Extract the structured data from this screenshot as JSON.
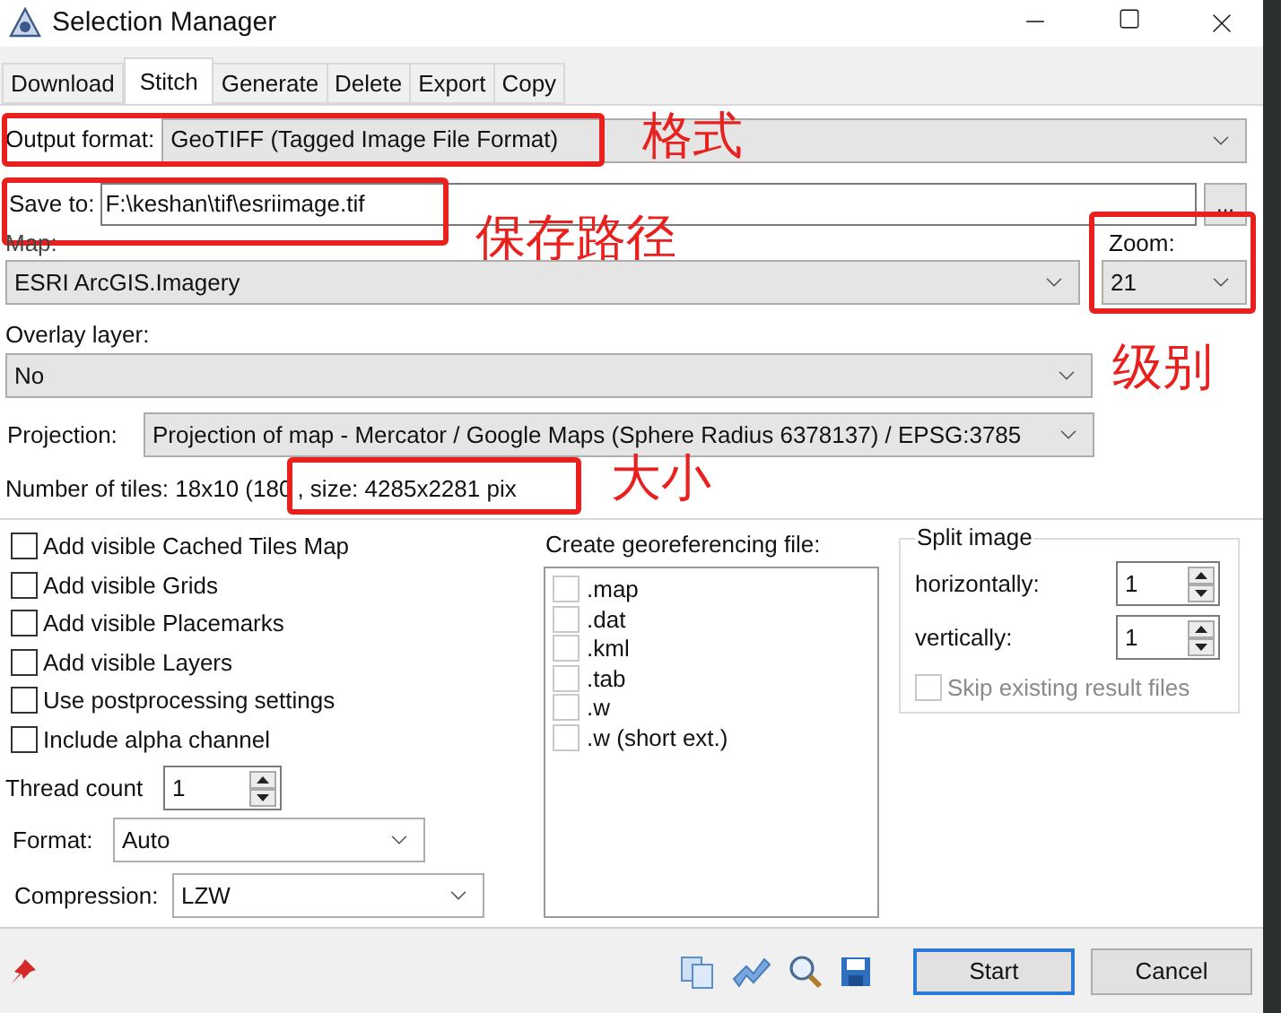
{
  "window": {
    "title": "Selection Manager"
  },
  "tabs": [
    {
      "label": "Download",
      "selected": false
    },
    {
      "label": "Stitch",
      "selected": true
    },
    {
      "label": "Generate",
      "selected": false
    },
    {
      "label": "Delete",
      "selected": false
    },
    {
      "label": "Export",
      "selected": false
    },
    {
      "label": "Copy",
      "selected": false
    }
  ],
  "output_format": {
    "label": "Output format:",
    "value": "GeoTIFF (Tagged Image File Format)",
    "annotation": "格式"
  },
  "save_to": {
    "label": "Save to:",
    "value": "F:\\keshan\\tif\\esriimage.tif",
    "browse": "...",
    "annotation": "保存路径"
  },
  "map": {
    "label": "Map:",
    "value": "ESRI ArcGIS.Imagery"
  },
  "zoom": {
    "label": "Zoom:",
    "value": "21",
    "annotation": "级别"
  },
  "overlay": {
    "label": "Overlay layer:",
    "value": "No"
  },
  "projection": {
    "label": "Projection:",
    "value": "Projection of map - Mercator / Google Maps (Sphere Radius 6378137) / EPSG:3785"
  },
  "tiles": {
    "count": "Number of tiles: 18x10 (180",
    "size": ", size: 4285x2281 pix",
    "annotation": "大小"
  },
  "options": [
    {
      "label": "Add visible Cached Tiles Map",
      "checked": false
    },
    {
      "label": "Add visible Grids",
      "checked": false
    },
    {
      "label": "Add visible Placemarks",
      "checked": false
    },
    {
      "label": "Add visible Layers",
      "checked": false
    },
    {
      "label": "Use postprocessing settings",
      "checked": false
    },
    {
      "label": "Include alpha channel",
      "checked": false
    }
  ],
  "thread_count": {
    "label": "Thread count",
    "value": "1"
  },
  "format": {
    "label": "Format:",
    "value": "Auto"
  },
  "compression": {
    "label": "Compression:",
    "value": "LZW"
  },
  "georef": {
    "title": "Create georeferencing file:",
    "files": [
      {
        "label": ".map",
        "checked": false
      },
      {
        "label": ".dat",
        "checked": false
      },
      {
        "label": ".kml",
        "checked": false
      },
      {
        "label": ".tab",
        "checked": false
      },
      {
        "label": ".w",
        "checked": false
      },
      {
        "label": ".w (short ext.)",
        "checked": false
      }
    ]
  },
  "split": {
    "title": "Split image",
    "horizontally": {
      "label": "horizontally:",
      "value": "1"
    },
    "vertically": {
      "label": "vertically:",
      "value": "1"
    },
    "skip": {
      "label": "Skip existing result files",
      "checked": false,
      "disabled": true
    }
  },
  "buttons": [
    {
      "label": "Start",
      "default": true
    },
    {
      "label": "Cancel",
      "default": false
    }
  ]
}
